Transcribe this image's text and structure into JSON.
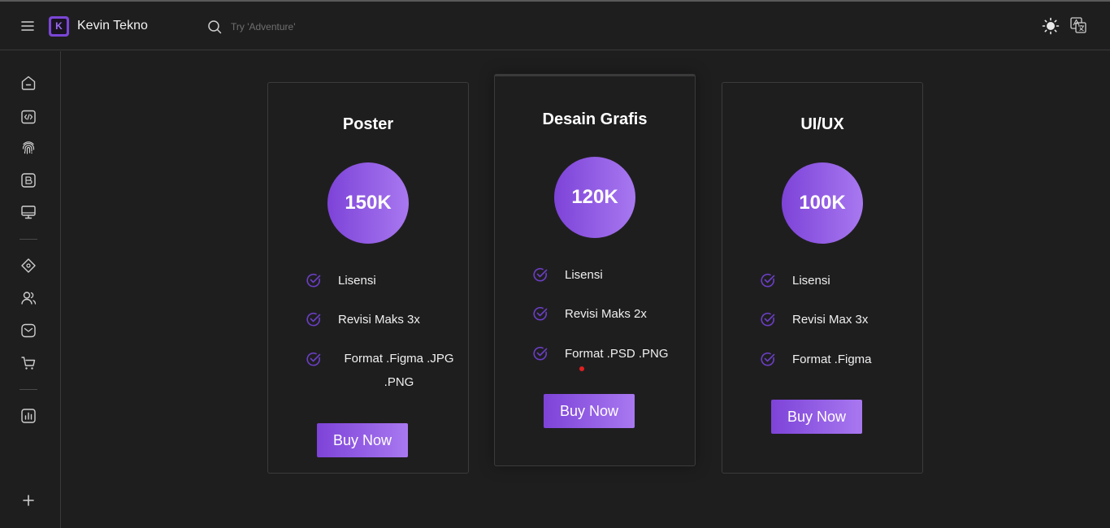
{
  "header": {
    "app_title": "Kevin Tekno",
    "logo_letter": "K",
    "search_placeholder": "Try 'Adventure'"
  },
  "sidebar": {
    "items": [
      "home-icon",
      "code-icon",
      "fingerprint-icon",
      "blog-icon",
      "monitor-icon",
      "component-icon",
      "users-icon",
      "mail-icon",
      "cart-icon",
      "chart-icon",
      "plus-icon"
    ]
  },
  "colors": {
    "accent_start": "#7d43d8",
    "accent_end": "#a878f0",
    "background": "#1f1e1f"
  },
  "cards": [
    {
      "title": "Poster",
      "price": "150K",
      "features": [
        "Lisensi",
        "Revisi Maks 3x",
        "Format .Figma .JPG .PNG"
      ],
      "button": "Buy Now"
    },
    {
      "title": "Desain Grafis",
      "price": "120K",
      "features": [
        "Lisensi",
        "Revisi Maks 2x",
        "Format .PSD .PNG"
      ],
      "button": "Buy Now"
    },
    {
      "title": "UI/UX",
      "price": "100K",
      "features": [
        "Lisensi",
        "Revisi Max 3x",
        "Format .Figma"
      ],
      "button": "Buy Now"
    }
  ]
}
